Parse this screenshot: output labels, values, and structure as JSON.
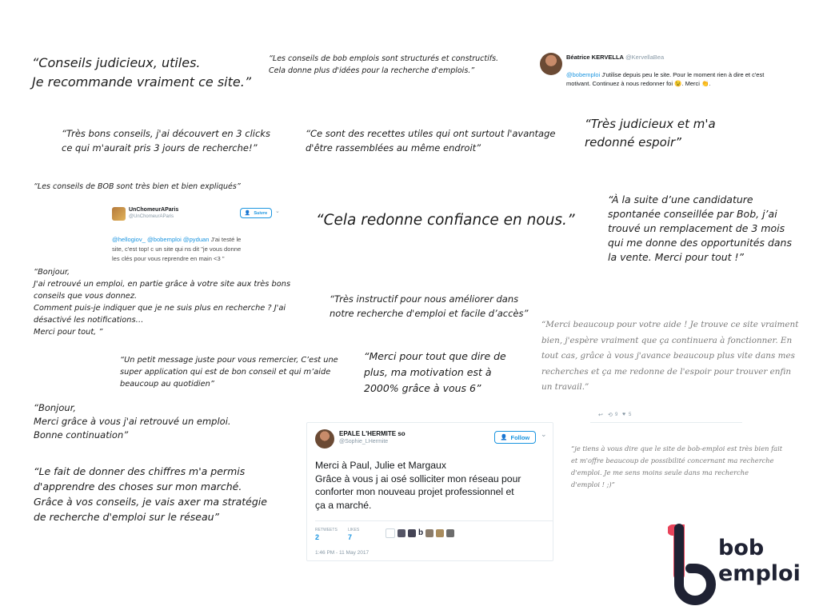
{
  "quotes": {
    "q1": "“Conseils judicieux, utiles.\nJe recommande vraiment ce site.”",
    "q2": "“Les conseils de bob emplois sont structurés et constructifs.\n Cela donne plus d'idées pour la recherche d'emplois.”",
    "q3": "“Très bons conseils, j'ai découvert en 3 clicks\nce qui m'aurait pris 3 jours de recherche!”",
    "q4": "“Ce sont des recettes utiles qui ont surtout l'avantage\nd'être rassemblées au même endroit”",
    "q5": "“Très judicieux et m'a\nredonné espoir”",
    "q6": "“Les conseils de BOB sont très bien et bien expliqués”",
    "q7": "“Cela redonne confiance en nous.”",
    "q8": "“À la suite d’une candidature\nspontanée conseillée par Bob, j’ai\ntrouvé un remplacement de 3 mois\nqui me donne des opportunités dans\nla vente. Merci pour tout !”",
    "q9": "“Bonjour,\nJ'ai retrouvé un emploi, en partie grâce à votre site aux très bons\nconseils que vous donnez.\nComment puis-je indiquer que je ne suis plus en recherche ? J'ai\ndésactivé les notifications…\nMerci pour tout, ”",
    "q10": "“Très instructif pour nous améliorer dans\nnotre recherche d'emploi et facile d’accès”",
    "q11": "“Merci beaucoup pour votre aide ! Je trouve ce site vraiment\n bien, j'espère vraiment que ça continuera à fonctionner. En\n tout cas, grâce à vous j'avance beaucoup plus vite dans mes\n recherches et ça me redonne de l'espoir pour trouver enfin\n un travail.”",
    "q12": "“Un petit message juste pour vous remercier, C’est une\nsuper application qui est de bon conseil et qui m’aide\nbeaucoup au quotidien”",
    "q13": "“Merci pour tout que dire de\nplus, ma motivation est à\n2000% grâce à vous 6”",
    "q14": "“Bonjour,\nMerci grâce à vous j'ai retrouvé un emploi.\nBonne continuation”",
    "q15": "“Le fait de donner des chiffres m'a permis\nd'apprendre des choses sur mon marché.\nGrâce à vos conseils, je vais axer ma stratégie\nde recherche d'emploi sur le réseau”",
    "q16": "“je tiens à vous dire que le site de bob-emploi est très bien fait\n et m'offre beaucoup de possibilité concernant ma recherche\n d'emploi. Je me sens moins seule dans ma recherche\n d'emploi ! ;)”"
  },
  "tweet_beatrice": {
    "name": "Béatrice KERVELLA",
    "handle": "@KervellaBea",
    "mention": "@bobemploi",
    "text": " J'utilise depuis peu le site. Pour le moment rien à dire et c'est\nmotivant. Continuez à nous redonner foi 😉. Merci 👏."
  },
  "tweet_chomeur": {
    "name": "UnChomeurAParis",
    "handle": "@UnChomeurAParis",
    "follow": "Suivre",
    "mentions": "@hellogiov_ @bobemploi @pyduan",
    "text": " J'ai testé le\nsite, c'est top! c un site qui ns dit \"je vous donne\nles clés pour vous reprendre en main <3 \""
  },
  "tweet_small": {
    "retweets": "9",
    "likes": "5"
  },
  "tweet_epale": {
    "name": "EPALE L'HERMITE so",
    "handle": "@Sophie_LHermite",
    "follow": "Follow",
    "text": "Merci à Paul, Julie et Margaux\nGrâce à vous j ai osé solliciter mon réseau pour\nconforter mon nouveau projet professionnel et\nça a marché.",
    "retweets_label": "RETWEETS",
    "retweets": "2",
    "likes_label": "LIKES",
    "likes": "7",
    "timestamp": "1:46 PM - 11 May 2017"
  },
  "logo": {
    "line1": "bob",
    "line2": "emploi",
    "color": "#1f2233",
    "accent": "#e8435a"
  }
}
